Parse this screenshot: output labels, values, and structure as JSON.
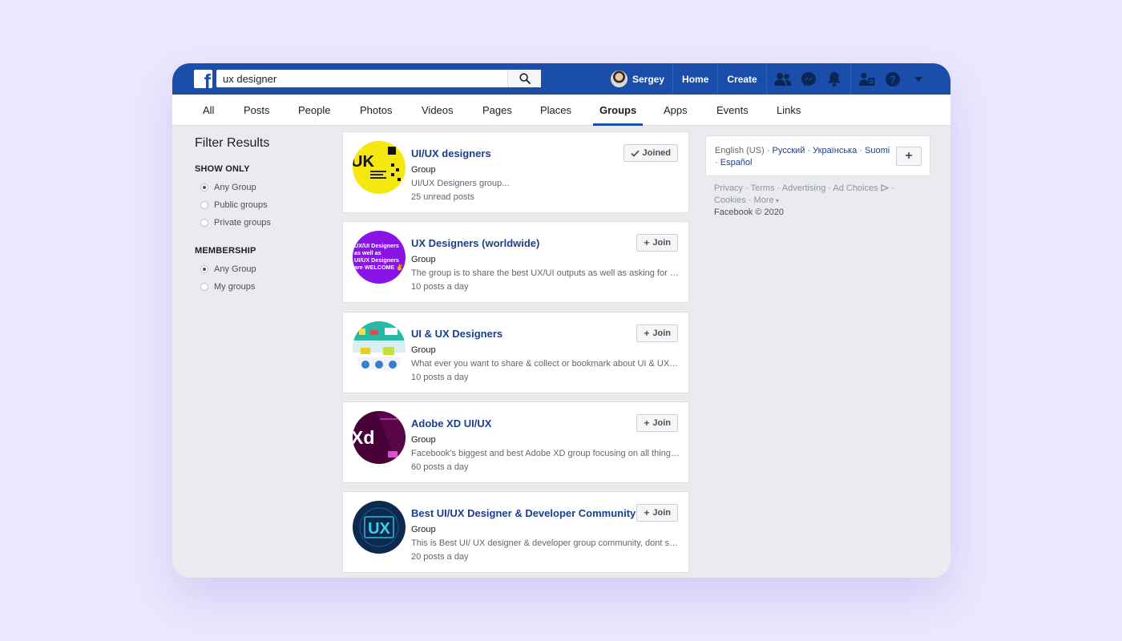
{
  "search": {
    "query": "ux designer"
  },
  "header": {
    "user_name": "Sergey",
    "home_label": "Home",
    "create_label": "Create"
  },
  "tabs": [
    {
      "label": "All"
    },
    {
      "label": "Posts"
    },
    {
      "label": "People"
    },
    {
      "label": "Photos"
    },
    {
      "label": "Videos"
    },
    {
      "label": "Pages"
    },
    {
      "label": "Places"
    },
    {
      "label": "Groups",
      "active": true
    },
    {
      "label": "Apps"
    },
    {
      "label": "Events"
    },
    {
      "label": "Links"
    }
  ],
  "filters": {
    "title": "Filter Results",
    "show_only": {
      "heading": "SHOW ONLY",
      "options": [
        "Any Group",
        "Public groups",
        "Private groups"
      ],
      "selected": "Any Group"
    },
    "membership": {
      "heading": "MEMBERSHIP",
      "options": [
        "Any Group",
        "My groups"
      ],
      "selected": "Any Group"
    }
  },
  "results": [
    {
      "name": "UI/UX designers",
      "type": "Group",
      "description": "UI/UX Designers group...",
      "meta": "25 unread posts",
      "button": "Joined",
      "button_icon": "check-icon",
      "thumb_text": "UK",
      "thumb_color": "#f5e80f"
    },
    {
      "name": "UX Designers (worldwide)",
      "type": "Group",
      "description": "The group is to share the best UX/UI outputs as well as asking for feedback and sharing resources",
      "meta": "10 posts a day",
      "button": "Join",
      "button_icon": "plus-icon",
      "thumb_text": "UX/UI Designers as well as UI/UX Designers are WELCOME",
      "thumb_color": "#8a13e8"
    },
    {
      "name": "UI & UX Designers",
      "type": "Group",
      "description": "What ever you want to share & collect or bookmark about UI & UX design",
      "meta": "10 posts a day",
      "button": "Join",
      "button_icon": "plus-icon",
      "thumb_text": "",
      "thumb_color": "#27b9a6"
    },
    {
      "name": "Adobe XD UI/UX",
      "type": "Group",
      "description": "Facebook’s biggest and best Adobe XD group focusing on all things design",
      "meta": "60 posts a day",
      "button": "Join",
      "button_icon": "plus-icon",
      "thumb_text": "Xd",
      "thumb_color": "#470137"
    },
    {
      "name": "Best UI/UX Designer & Developer Community",
      "type": "Group",
      "description": "This is Best UI/ UX designer & developer group community, dont spam here",
      "meta": "20 posts a day",
      "button": "Join",
      "button_icon": "plus-icon",
      "thumb_text": "UX",
      "thumb_color": "#0c2a4d"
    }
  ],
  "languages": {
    "current": "English (US)",
    "links": [
      "Русский",
      "Українська",
      "Suomi",
      "Español"
    ],
    "add_label": "+"
  },
  "footer": {
    "links": [
      "Privacy",
      "Terms",
      "Advertising",
      "Ad Choices",
      "Cookies",
      "More"
    ],
    "copyright": "Facebook © 2020"
  },
  "colors": {
    "header_blue": "#1b4eaa",
    "link_blue": "#1b3e8f",
    "page_background": "#ebe7fd",
    "content_background": "#e9ebee"
  }
}
